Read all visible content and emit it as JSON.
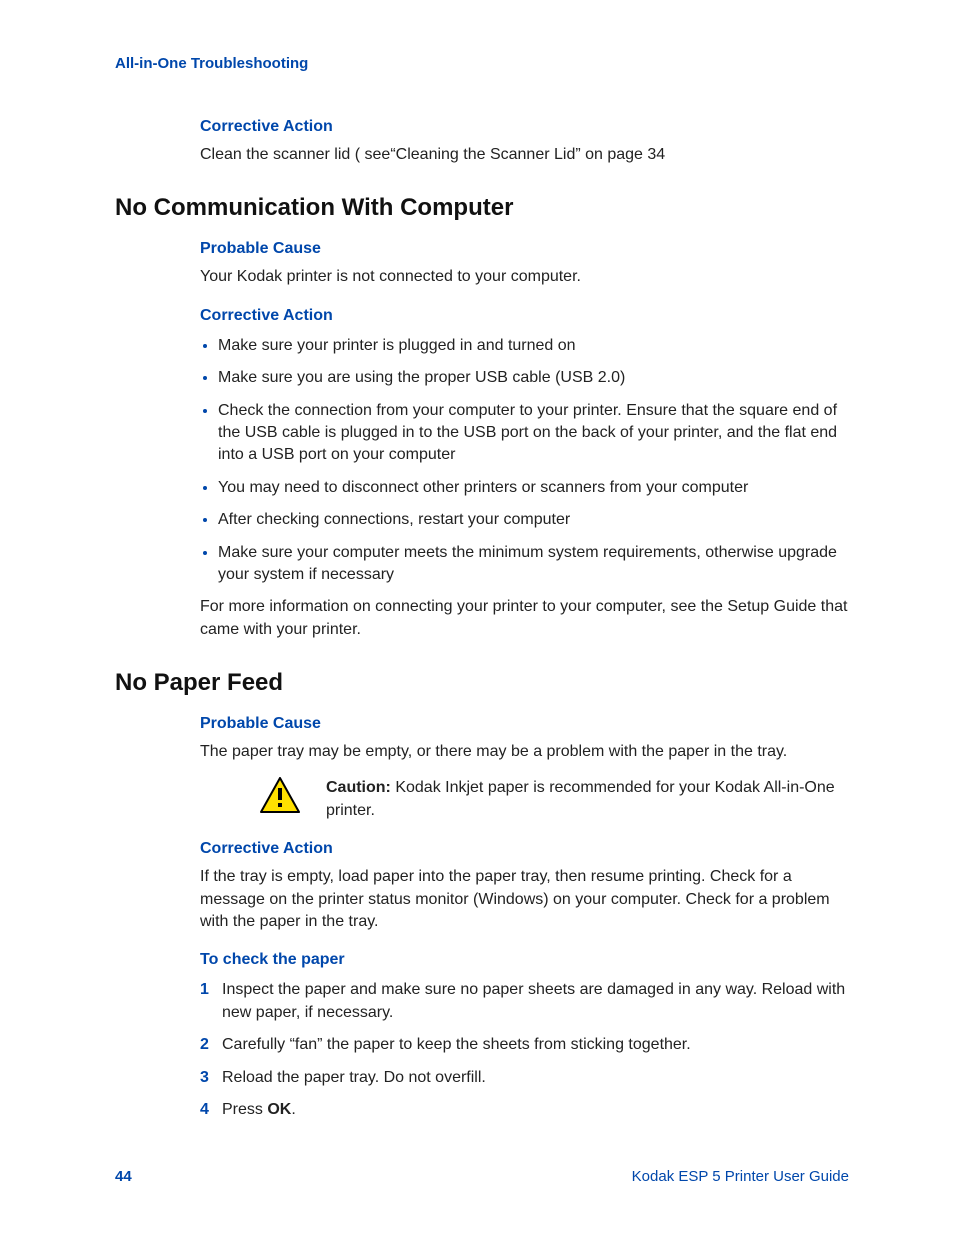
{
  "runningHeader": "All-in-One Troubleshooting",
  "section1": {
    "h3a": "Corrective Action",
    "p1": "Clean the scanner lid ( see“Cleaning the Scanner Lid” on page 34"
  },
  "section2": {
    "h2": "No Communication With Computer",
    "h3a": "Probable Cause",
    "p1": "Your Kodak printer is not connected to your computer.",
    "h3b": "Corrective Action",
    "bullets": [
      "Make sure your printer is plugged in and turned on",
      "Make sure you are using the proper USB cable (USB 2.0)",
      "Check the connection from your computer to your printer. Ensure that the square end of the USB cable is plugged in to the USB port on the back of your printer, and the flat end into a USB port on your computer",
      "You may need to disconnect other printers or scanners from your computer",
      "After checking connections, restart your computer",
      "Make sure your computer meets the minimum system requirements, otherwise upgrade your system if necessary"
    ],
    "p2": "For more information on connecting your printer to your computer, see the Setup Guide that came with your printer."
  },
  "section3": {
    "h2": "No Paper Feed",
    "h3a": "Probable Cause",
    "p1": "The paper tray may be empty, or there may be a problem with the paper in the tray.",
    "cautionBold": "Caution:",
    "cautionText": " Kodak Inkjet paper is recommended for your Kodak All-in-One printer.",
    "h3b": "Corrective Action",
    "p2": "If the tray is empty, load paper into the paper tray, then resume printing. Check for a message on the printer status monitor (Windows) on your computer. Check for a problem with the paper in the tray.",
    "h3c": "To check the paper",
    "steps": [
      "Inspect the paper and make sure no paper sheets are damaged in any way. Reload with new paper, if necessary.",
      "Carefully “fan” the paper to keep the sheets from sticking together.",
      "Reload the paper tray. Do not overfill.",
      {
        "pre": "Press ",
        "bold": "OK",
        "post": "."
      }
    ]
  },
  "footer": {
    "pageNo": "44",
    "guide": "Kodak ESP 5 Printer User Guide"
  }
}
